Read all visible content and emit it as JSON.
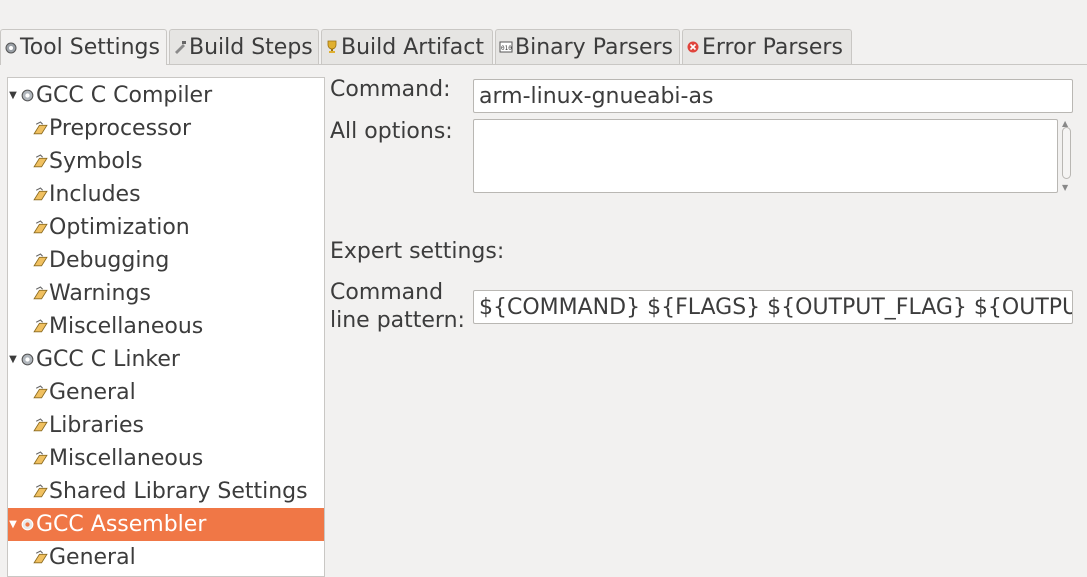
{
  "tabs": [
    {
      "label": "Tool Settings",
      "icon": "tool-settings-icon",
      "active": true
    },
    {
      "label": "Build Steps",
      "icon": "build-steps-icon",
      "active": false
    },
    {
      "label": "Build Artifact",
      "icon": "build-artifact-icon",
      "active": false
    },
    {
      "label": "Binary Parsers",
      "icon": "binary-parsers-icon",
      "active": false
    },
    {
      "label": "Error Parsers",
      "icon": "error-parsers-icon",
      "active": false
    }
  ],
  "tree": {
    "items": [
      {
        "label": "GCC C Compiler",
        "level": 0,
        "expanded": true
      },
      {
        "label": "Preprocessor",
        "level": 1
      },
      {
        "label": "Symbols",
        "level": 1
      },
      {
        "label": "Includes",
        "level": 1
      },
      {
        "label": "Optimization",
        "level": 1
      },
      {
        "label": "Debugging",
        "level": 1
      },
      {
        "label": "Warnings",
        "level": 1
      },
      {
        "label": "Miscellaneous",
        "level": 1
      },
      {
        "label": "GCC C Linker",
        "level": 0,
        "expanded": true
      },
      {
        "label": "General",
        "level": 1
      },
      {
        "label": "Libraries",
        "level": 1
      },
      {
        "label": "Miscellaneous",
        "level": 1
      },
      {
        "label": "Shared Library Settings",
        "level": 1
      },
      {
        "label": "GCC Assembler",
        "level": 0,
        "expanded": true,
        "selected": true
      },
      {
        "label": "General",
        "level": 1
      }
    ]
  },
  "form": {
    "command_label": "Command:",
    "command_value": "arm-linux-gnueabi-as",
    "all_options_label": "All options:",
    "all_options_value": "",
    "expert_settings_label": "Expert settings:",
    "pattern_label_line1": "Command",
    "pattern_label_line2": "line pattern:",
    "pattern_value": "${COMMAND} ${FLAGS} ${OUTPUT_FLAG} ${OUTPUT_PREFIX}${OUTPUT} ${INPUTS}"
  },
  "colors": {
    "selection": "#f07746",
    "background": "#f2f1f0"
  }
}
